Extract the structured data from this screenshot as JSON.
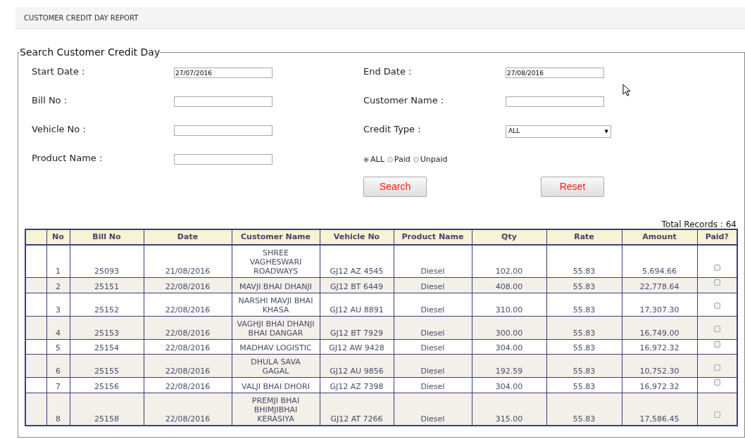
{
  "page_title": "CUSTOMER CREDIT DAY REPORT",
  "search_panel": {
    "legend": "Search Customer Credit Day",
    "fields": [
      {
        "label": "Start Date :",
        "kind": "text",
        "value": "27/07/2016"
      },
      {
        "label": "End Date :",
        "kind": "text",
        "value": "27/08/2016"
      },
      {
        "label": "Bill No :",
        "kind": "text"
      },
      {
        "label": "Customer Name :",
        "kind": "text"
      },
      {
        "label": "Vehicle No :",
        "kind": "text"
      },
      {
        "label": "Credit Type :",
        "kind": "select",
        "value": "ALL",
        "arrow": "▼"
      },
      {
        "label": "Product Name :",
        "kind": "text"
      },
      {
        "kind": "radios",
        "options": [
          {
            "label": "ALL",
            "selected": true
          },
          {
            "label": "Paid",
            "selected": false
          },
          {
            "label": "Unpaid",
            "selected": false
          }
        ]
      }
    ],
    "buttons": [
      "Search",
      "Reset"
    ]
  },
  "total_records": "Total Records : 64",
  "table": {
    "columns": [
      "No",
      "Bill No",
      "Date",
      "Customer Name",
      "Vehicle No",
      "Product Name",
      "Qty",
      "Rate",
      "Amount",
      "Paid?"
    ],
    "rows": [
      {
        "no": "1",
        "bill_no": "25093",
        "date": "21/08/2016",
        "customer": "SHREE VAGHESWARI ROADWAYS",
        "vehicle": "GJ12 AZ 4545",
        "product": "Diesel",
        "qty": "102.00",
        "rate": "55.83",
        "amount": "5,694.66",
        "paid": false
      },
      {
        "no": "2",
        "bill_no": "25151",
        "date": "22/08/2016",
        "customer": "MAVJI BHAI DHANJI",
        "vehicle": "GJ12 BT 6449",
        "product": "Diesel",
        "qty": "408.00",
        "rate": "55.83",
        "amount": "22,778.64",
        "paid": false
      },
      {
        "no": "3",
        "bill_no": "25152",
        "date": "22/08/2016",
        "customer": "NARSHI MAVJI BHAI KHASA",
        "vehicle": "GJ12 AU 8891",
        "product": "Diesel",
        "qty": "310.00",
        "rate": "55.83",
        "amount": "17,307.30",
        "paid": false
      },
      {
        "no": "4",
        "bill_no": "25153",
        "date": "22/08/2016",
        "customer": "VAGHJI BHAI DHANJI BHAI DANGAR",
        "vehicle": "GJ12 BT 7929",
        "product": "Diesel",
        "qty": "300.00",
        "rate": "55.83",
        "amount": "16,749.00",
        "paid": false
      },
      {
        "no": "5",
        "bill_no": "25154",
        "date": "22/08/2016",
        "customer": "MADHAV LOGISTIC",
        "vehicle": "GJ12 AW 9428",
        "product": "Diesel",
        "qty": "304.00",
        "rate": "55.83",
        "amount": "16,972.32",
        "paid": false
      },
      {
        "no": "6",
        "bill_no": "25155",
        "date": "22/08/2016",
        "customer": "DHULA SAVA GAGAL",
        "vehicle": "GJ12 AU 9856",
        "product": "Diesel",
        "qty": "192.59",
        "rate": "55.83",
        "amount": "10,752.30",
        "paid": false
      },
      {
        "no": "7",
        "bill_no": "25156",
        "date": "22/08/2016",
        "customer": "VALJI BHAI DHORI",
        "vehicle": "GJ12 AZ 7398",
        "product": "Diesel",
        "qty": "304.00",
        "rate": "55.83",
        "amount": "16,972.32",
        "paid": false
      },
      {
        "no": "8",
        "bill_no": "25158",
        "date": "22/08/2016",
        "customer": "PREMJI BHAI BHIMJIBHAI KERASIYA",
        "vehicle": "GJ12 AT 7266",
        "product": "Diesel",
        "qty": "315.00",
        "rate": "55.83",
        "amount": "17,586.45",
        "paid": false
      }
    ]
  }
}
